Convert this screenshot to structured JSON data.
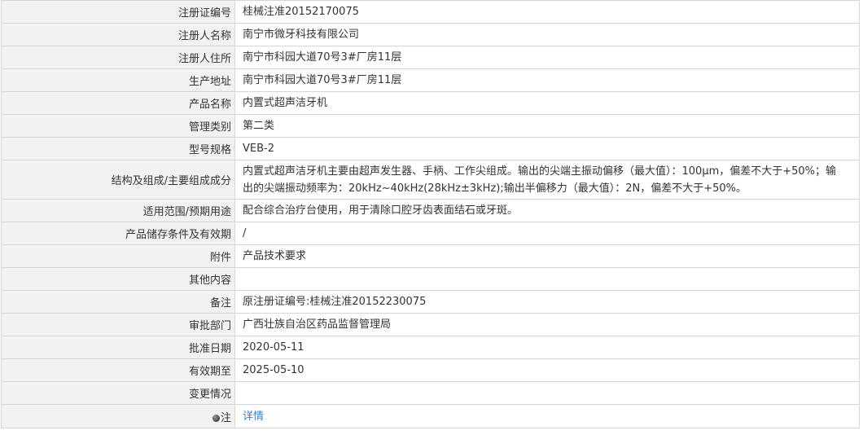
{
  "rows": [
    {
      "label": "注册证编号",
      "value": "桂械注准20152170075"
    },
    {
      "label": "注册人名称",
      "value": "南宁市微牙科技有限公司"
    },
    {
      "label": "注册人住所",
      "value": "南宁市科园大道70号3#厂房11层"
    },
    {
      "label": "生产地址",
      "value": "南宁市科园大道70号3#厂房11层"
    },
    {
      "label": "产品名称",
      "value": "内置式超声洁牙机"
    },
    {
      "label": "管理类别",
      "value": "第二类"
    },
    {
      "label": "型号规格",
      "value": "VEB-2"
    },
    {
      "label": "结构及组成/主要组成成分",
      "value": "内置式超声洁牙机主要由超声发生器、手柄、工作尖组成。输出的尖端主振动偏移（最大值）：100μm，偏差不大于+50%；输出的尖端振动频率为：20kHz~40kHz(28kHz±3kHz);输出半偏移力（最大值）：2N，偏差不大于+50%。"
    },
    {
      "label": "适用范围/预期用途",
      "value": "配合综合治疗台使用，用于清除口腔牙齿表面结石或牙斑。"
    },
    {
      "label": "产品储存条件及有效期",
      "value": "/"
    },
    {
      "label": "附件",
      "value": "产品技术要求"
    },
    {
      "label": "其他内容",
      "value": ""
    },
    {
      "label": "备注",
      "value": "原注册证编号:桂械注准20152230075"
    },
    {
      "label": "审批部门",
      "value": "广西壮族自治区药品监督管理局"
    },
    {
      "label": "批准日期",
      "value": "2020-05-11"
    },
    {
      "label": "有效期至",
      "value": "2025-05-10"
    },
    {
      "label": "变更情况",
      "value": ""
    },
    {
      "label": "注",
      "value": "详情"
    }
  ],
  "icons": {
    "note_pin": "map-pin-icon"
  },
  "colors": {
    "label_bg": "#f2f2f2",
    "border": "#d6d6d6",
    "link": "#3d7fc6"
  }
}
